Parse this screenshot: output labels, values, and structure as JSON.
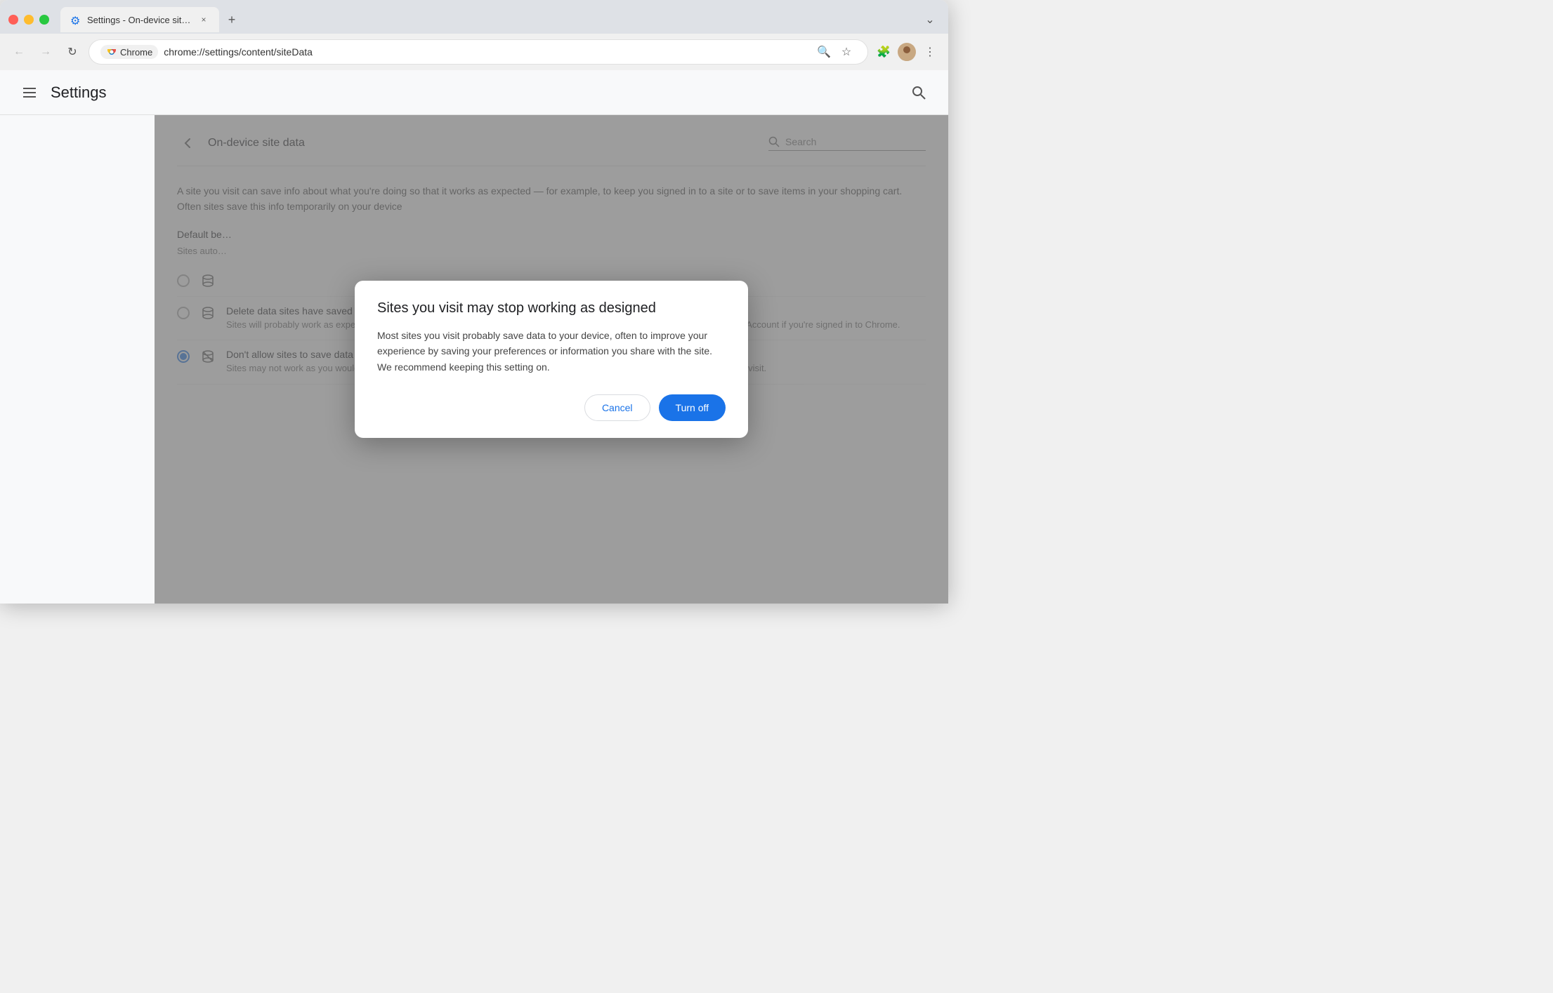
{
  "browser": {
    "tab": {
      "title": "Settings - On-device site da…",
      "favicon": "⚙",
      "close_label": "×",
      "new_tab_label": "+",
      "dropdown_label": "⌄"
    },
    "nav": {
      "back_label": "←",
      "forward_label": "→",
      "reload_label": "↻"
    },
    "address": {
      "chrome_label": "Chrome",
      "url": "chrome://settings/content/siteData"
    },
    "toolbar": {
      "zoom_label": "🔍",
      "bookmark_label": "☆",
      "extensions_label": "🧩",
      "menu_label": "⋮"
    }
  },
  "settings": {
    "header": {
      "menu_label": "☰",
      "title": "Settings",
      "search_label": "🔍"
    },
    "page": {
      "back_label": "←",
      "title": "On-device site data",
      "search_placeholder": "Search"
    },
    "description": "A site you visit can save info about what you're doing so that it works as expected — for example, to keep you signed in to a site or to save items in your shopping cart. Often sites save this info temporarily on your device",
    "default_behavior_label": "Default be…",
    "sites_auto_label": "Sites auto…",
    "options": [
      {
        "id": "option1",
        "selected": false,
        "icon": "🗄",
        "title": "",
        "desc": ""
      },
      {
        "id": "option2",
        "selected": false,
        "icon": "🗄",
        "title": "Delete data sites have saved to your device when you close all windows",
        "desc": "Sites will probably work as expected. You'll be signed out of most sites when you close all Chrome windows, except your Google Account if you're signed in to Chrome."
      },
      {
        "id": "option3",
        "selected": true,
        "icon": "🚫",
        "title": "Don't allow sites to save data on your device (not recommended)",
        "desc": "Sites may not work as you would expect. Choose this option if you don't want to leave information on your device about sites you visit."
      }
    ]
  },
  "dialog": {
    "title": "Sites you visit may stop working as designed",
    "body": "Most sites you visit probably save data to your device, often to improve your experience by saving your preferences or information you share with the site. We recommend keeping this setting on.",
    "cancel_label": "Cancel",
    "confirm_label": "Turn off"
  }
}
